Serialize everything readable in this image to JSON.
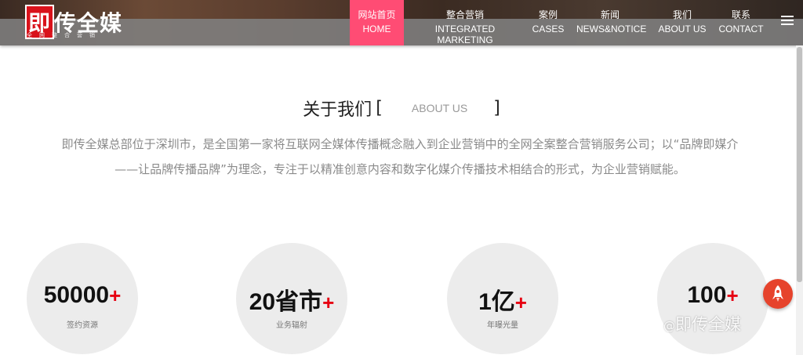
{
  "header": {
    "logo_text": "即传全媒",
    "logo_subtitle": "全网整合营销",
    "nav": [
      {
        "cn": "网站首页",
        "en": "HOME",
        "active": true
      },
      {
        "cn": "整合营销",
        "en": "INTEGRATED MARKETING"
      },
      {
        "cn": "案例",
        "en": "CASES"
      },
      {
        "cn": "新闻",
        "en": "NEWS&NOTICE"
      },
      {
        "cn": "我们",
        "en": "ABOUT US"
      },
      {
        "cn": "联系",
        "en": "CONTACT"
      }
    ],
    "menu_icon": "hamburger-icon",
    "active_color": "#ff4c74"
  },
  "about": {
    "title_cn": "关于我们",
    "bracket_open": "[",
    "title_en": "ABOUT US",
    "bracket_close": "]",
    "line1": "即传全媒总部位于深圳市，是全国第一家将互联网全媒体传播概念融入到企业营销中的全网全案整合营销服务公司；以“品牌即媒介",
    "line2": "——让品牌传播品牌”为理念，专注于以精准创意内容和数字化媒介传播技术相结合的形式，为企业营销赋能。"
  },
  "stats": [
    {
      "value": "50000",
      "plus": "+",
      "label": "签约资源"
    },
    {
      "value": "20省市",
      "plus": "+",
      "label": "业务辐射"
    },
    {
      "value": "1亿",
      "plus": "+",
      "label": "年曝光量"
    },
    {
      "value": "100",
      "plus": "+",
      "label": ""
    }
  ],
  "rocket_icon": "rocket-icon",
  "watermark": {
    "at": "@",
    "text": "即传全媒"
  },
  "colors": {
    "accent_red": "#e60012",
    "rocket_bg": "#e6432c"
  }
}
